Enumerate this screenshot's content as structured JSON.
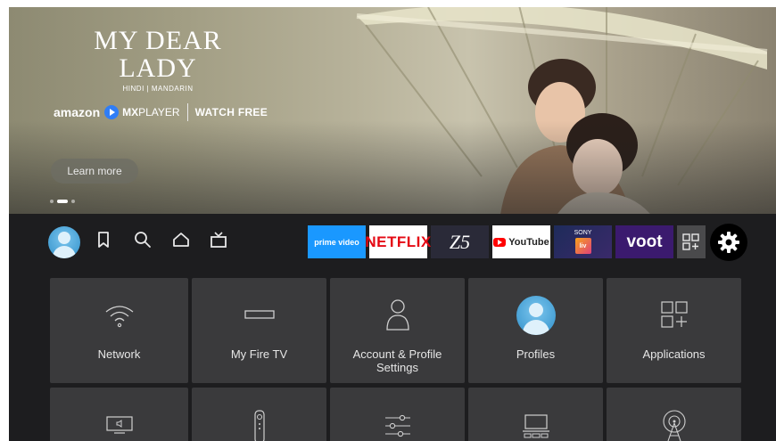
{
  "hero": {
    "title_line1": "MY DEAR",
    "title_line2": "LADY",
    "languages": "HINDI | MANDARIN",
    "brand_amazon": "amazon",
    "brand_mx": "MX",
    "brand_player": "PLAYER",
    "watch_free": "WATCH FREE",
    "learn_more": "Learn more",
    "carousel_pages": 3,
    "carousel_active": 2
  },
  "nav": {
    "icons": [
      "profile-avatar",
      "bookmark-icon",
      "search-icon",
      "home-icon",
      "live-tv-icon"
    ]
  },
  "apps": {
    "prime": "prime video",
    "netflix": "NETFLIX",
    "z5": "Z5",
    "youtube": "YouTube",
    "sonyliv_top": "SONY",
    "sonyliv_box": "liv",
    "voot": "voot",
    "more_icon": "app-grid-icon",
    "settings_icon": "gear-icon"
  },
  "settings": {
    "tiles_row1": [
      {
        "label": "Network",
        "icon": "wifi-icon"
      },
      {
        "label": "My Fire TV",
        "icon": "fire-tv-device-icon"
      },
      {
        "label_line1": "Account & Profile",
        "label_line2": "Settings",
        "icon": "person-icon"
      },
      {
        "label": "Profiles",
        "icon": "profile-avatar-icon"
      },
      {
        "label": "Applications",
        "icon": "applications-icon"
      }
    ],
    "tiles_row2_icons": [
      "display-sound-icon",
      "remote-icon",
      "preferences-sliders-icon",
      "computer-icon",
      "broadcast-antenna-icon"
    ]
  },
  "colors": {
    "background": "#1d1d1f",
    "tile": "#3a3a3c",
    "prime": "#1a98ff",
    "netflix_red": "#e50914",
    "voot": "#3b1a6e",
    "avatar": "#2f8fc9"
  }
}
